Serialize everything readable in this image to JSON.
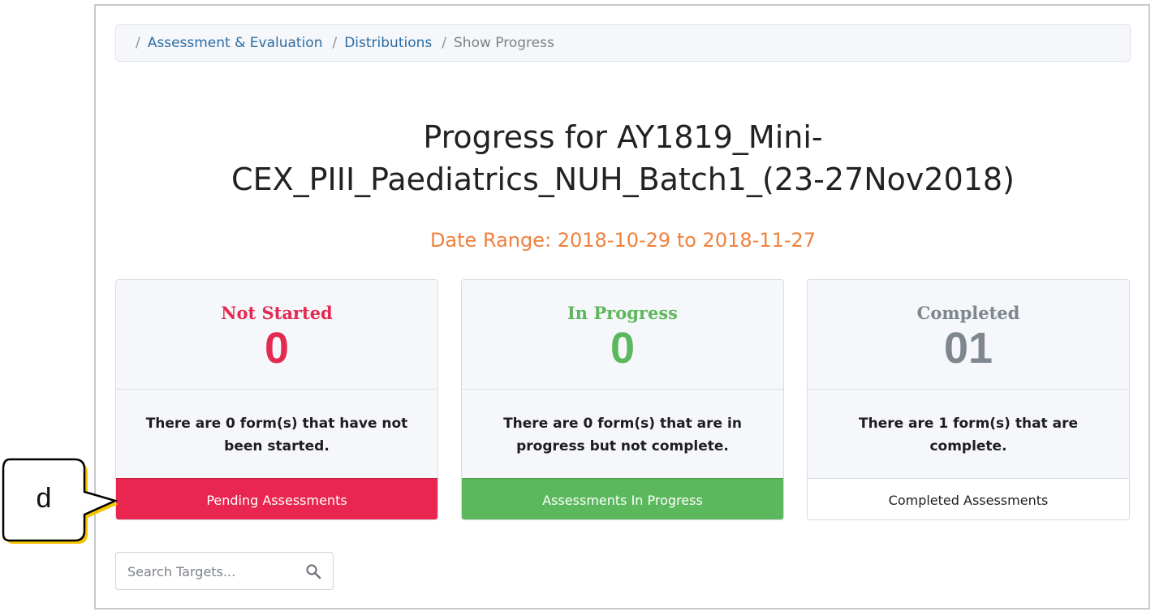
{
  "breadcrumb": {
    "items": [
      "Assessment & Evaluation",
      "Distributions"
    ],
    "current": "Show Progress",
    "separator": "/"
  },
  "page": {
    "title_line1": "Progress for AY1819_Mini-",
    "title_line2": "CEX_PIII_Paediatrics_NUH_Batch1_(23-27Nov2018)",
    "date_range": "Date Range: 2018-10-29 to 2018-11-27"
  },
  "cards": [
    {
      "label": "Not Started",
      "count": "0",
      "description": "There are 0 form(s) that have not been started.",
      "button": "Pending Assessments",
      "color": "#e52a52"
    },
    {
      "label": "In Progress",
      "count": "0",
      "description": "There are 0 form(s) that are in progress but not complete.",
      "button": "Assessments In Progress",
      "color": "#5cb85c"
    },
    {
      "label": "Completed",
      "count": "01",
      "description": "There are 1 form(s) that are complete.",
      "button": "Completed Assessments",
      "color": "#7e868e"
    }
  ],
  "search": {
    "placeholder": "Search Targets...",
    "icon": "search-icon"
  },
  "callout": {
    "letter": "d",
    "color": "#f5c400"
  }
}
